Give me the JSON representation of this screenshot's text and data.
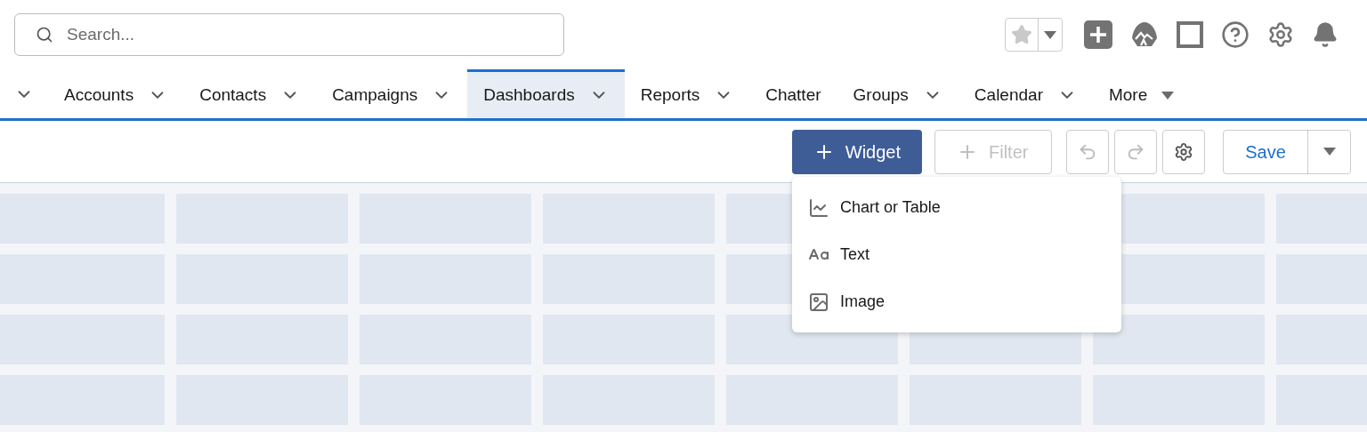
{
  "search": {
    "placeholder": "Search..."
  },
  "nav_tabs": [
    {
      "label": "Accounts",
      "selected": false,
      "kind": "chevron"
    },
    {
      "label": "Contacts",
      "selected": false,
      "kind": "chevron"
    },
    {
      "label": "Campaigns",
      "selected": false,
      "kind": "chevron"
    },
    {
      "label": "Dashboards",
      "selected": true,
      "kind": "chevron"
    },
    {
      "label": "Reports",
      "selected": false,
      "kind": "chevron"
    },
    {
      "label": "Chatter",
      "selected": false,
      "kind": "plain"
    },
    {
      "label": "Groups",
      "selected": false,
      "kind": "chevron"
    },
    {
      "label": "Calendar",
      "selected": false,
      "kind": "chevron"
    },
    {
      "label": "More",
      "selected": false,
      "kind": "caret"
    }
  ],
  "toolbar": {
    "widget_button": "Widget",
    "filter_button": {
      "label": "Filter",
      "disabled": true
    },
    "undo_disabled": true,
    "redo_disabled": true,
    "save_button": "Save"
  },
  "widget_menu": [
    {
      "label": "Chart or Table",
      "kind": "chart"
    },
    {
      "label": "Text",
      "kind": "text"
    },
    {
      "label": "Image",
      "kind": "image"
    }
  ]
}
